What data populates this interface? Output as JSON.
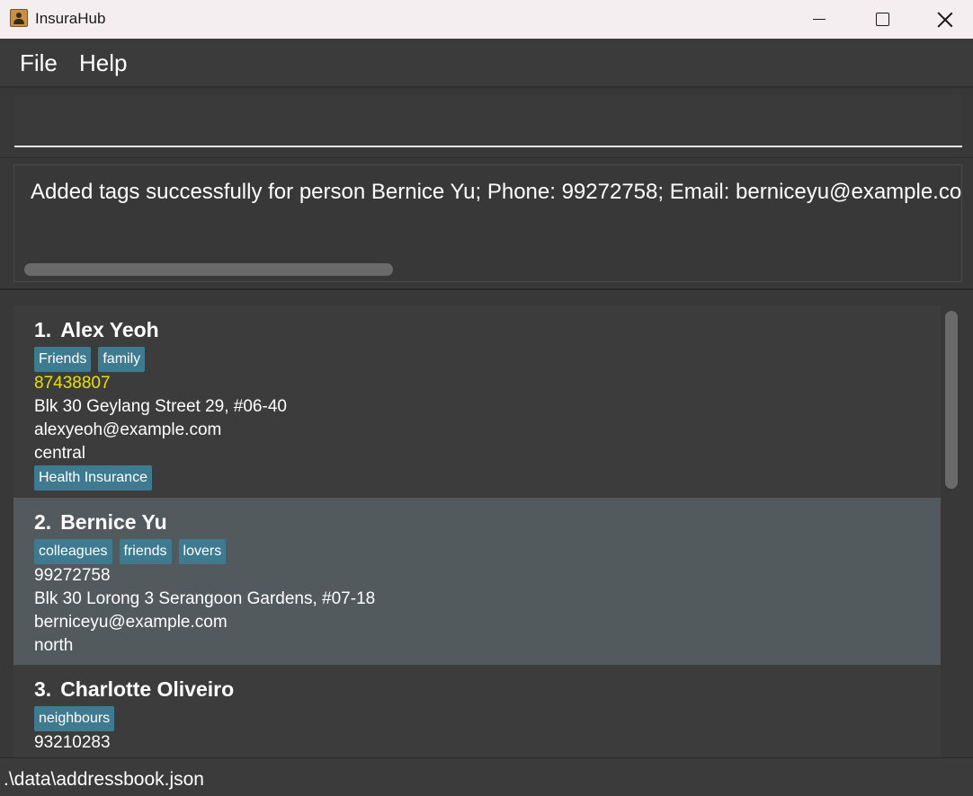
{
  "window": {
    "title": "InsuraHub",
    "icon": "address-book-icon",
    "controls": {
      "minimize": "minimize-icon",
      "maximize": "maximize-icon",
      "close": "close-icon"
    }
  },
  "menu": {
    "file_label": "File",
    "help_label": "Help"
  },
  "command": {
    "value": "",
    "placeholder": ""
  },
  "result": {
    "text": "Added tags successfully for person Bernice Yu; Phone: 99272758; Email: berniceyu@example.com"
  },
  "persons": [
    {
      "index": "1.",
      "name": "Alex Yeoh",
      "tags": [
        "Friends",
        "family"
      ],
      "phone": "87438807",
      "address": "Blk 30 Geylang Street 29, #06-40",
      "email": "alexyeoh@example.com",
      "region": "central",
      "insurance_tags": [
        "Health Insurance"
      ]
    },
    {
      "index": "2.",
      "name": "Bernice Yu",
      "tags": [
        "colleagues",
        "friends",
        "lovers"
      ],
      "phone": "99272758",
      "address": "Blk 30 Lorong 3 Serangoon Gardens, #07-18",
      "email": "berniceyu@example.com",
      "region": "north",
      "insurance_tags": []
    },
    {
      "index": "3.",
      "name": "Charlotte Oliveiro",
      "tags": [
        "neighbours"
      ],
      "phone": "93210283"
    }
  ],
  "status": {
    "file_path": ".\\data\\addressbook.json"
  },
  "colors": {
    "background": "#383838",
    "tag": "#3e7b91",
    "selected_card": "#525a5e",
    "phone_highlight": "#e8e000"
  }
}
